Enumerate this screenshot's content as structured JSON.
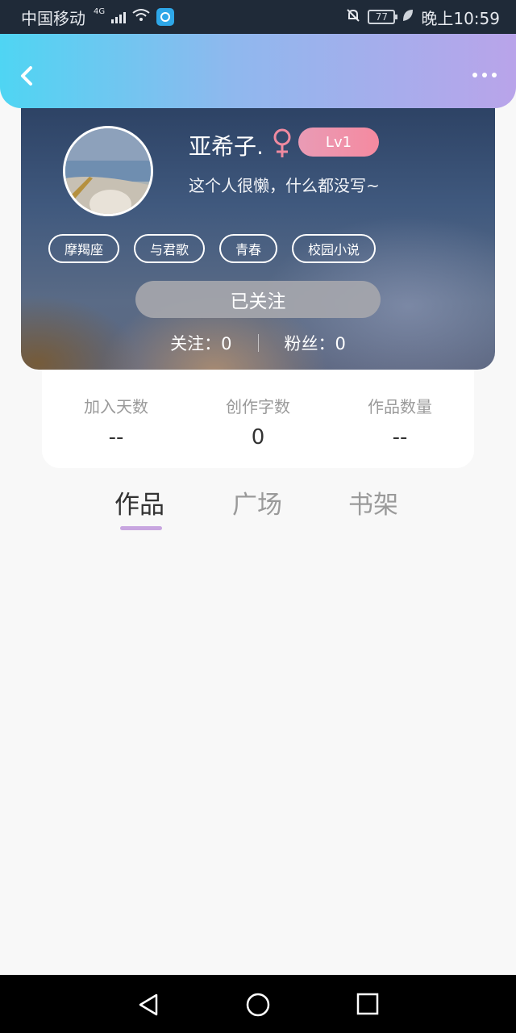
{
  "status_bar": {
    "carrier": "中国移动",
    "network": "4G",
    "battery": "77",
    "time": "晚上10:59"
  },
  "header": {
    "back_icon": "chevron-left-icon",
    "more_icon": "more-dots-icon"
  },
  "profile": {
    "username": "亚希子.",
    "gender_icon": "female-icon",
    "level": "Lv1",
    "bio": "这个人很懒，什么都没写~",
    "tags": [
      "摩羯座",
      "与君歌",
      "青春",
      "校园小说"
    ],
    "follow_button": "已关注",
    "following_label": "关注：0",
    "followers_label": "粉丝：0"
  },
  "stats": [
    {
      "label": "加入天数",
      "value": "--"
    },
    {
      "label": "创作字数",
      "value": "0"
    },
    {
      "label": "作品数量",
      "value": "--"
    }
  ],
  "tabs": [
    {
      "label": "作品",
      "active": true
    },
    {
      "label": "广场",
      "active": false
    },
    {
      "label": "书架",
      "active": false
    }
  ],
  "colors": {
    "header_start": "#4fd5f3",
    "header_end": "#b9a4ea",
    "level_badge": "#f58aa0",
    "tab_indicator": "#c8a6e0"
  }
}
